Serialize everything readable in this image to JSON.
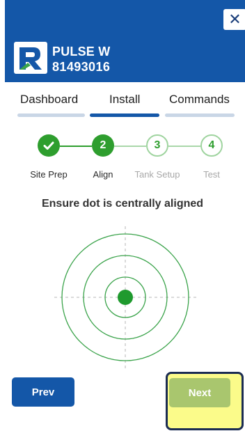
{
  "header": {
    "device_name": "PULSE W",
    "device_id": "81493016",
    "close_symbol": "✕"
  },
  "tabs": [
    {
      "label": "Dashboard",
      "active": false
    },
    {
      "label": "Install",
      "active": true
    },
    {
      "label": "Commands",
      "active": false
    }
  ],
  "steps": [
    {
      "number": "✓",
      "label": "Site Prep",
      "state": "done"
    },
    {
      "number": "2",
      "label": "Align",
      "state": "current"
    },
    {
      "number": "3",
      "label": "Tank Setup",
      "state": "pending"
    },
    {
      "number": "4",
      "label": "Test",
      "state": "pending"
    }
  ],
  "instruction": "Ensure dot is centrally aligned",
  "buttons": {
    "prev": "Prev",
    "next": "Next"
  },
  "colors": {
    "primary_blue": "#1457a8",
    "success_green": "#2e9e2e",
    "next_button": "#a9c66e",
    "highlight": "#fbfb8a"
  },
  "icons": {
    "logo": "rhino-r-logo",
    "close": "close-icon",
    "check": "check-icon"
  }
}
